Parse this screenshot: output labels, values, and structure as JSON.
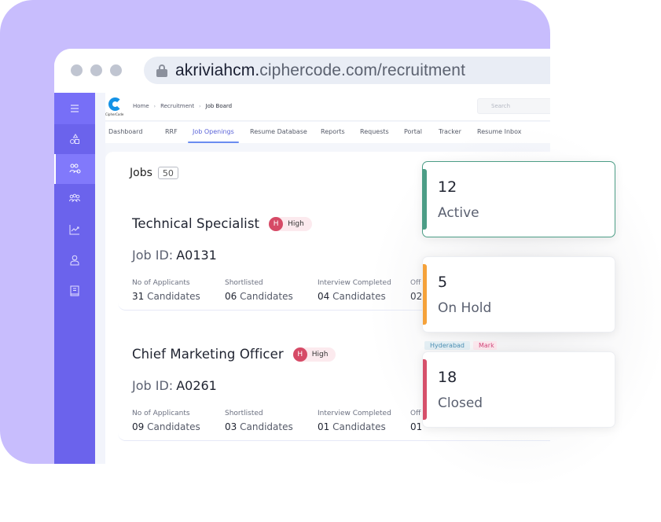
{
  "browser": {
    "url_host": "akriviahcm.",
    "url_rest": "ciphercode.com/recruitment"
  },
  "app": {
    "logo_text": "CipherCode",
    "breadcrumb": [
      "Home",
      "Recruitment",
      "Job Board"
    ],
    "search_placeholder": "Search",
    "tabs": [
      "Dashboard",
      "RRF",
      "Job Openings",
      "Resume Database",
      "Reports",
      "Requests",
      "Portal",
      "Tracker",
      "Resume Inbox"
    ],
    "active_tab": "Job Openings"
  },
  "sidebar": {
    "items": [
      {
        "icon": "menu-icon"
      },
      {
        "icon": "shapes-icon"
      },
      {
        "icon": "recruitment-icon",
        "active": true
      },
      {
        "icon": "team-icon"
      },
      {
        "icon": "analytics-icon"
      },
      {
        "icon": "user-icon"
      },
      {
        "icon": "book-icon"
      }
    ]
  },
  "jobs": {
    "title": "Jobs",
    "count": "50",
    "list": [
      {
        "title": "Technical Specialist",
        "priority_letter": "H",
        "priority": "High",
        "id_label": "Job ID:",
        "id": "A0131",
        "stats": [
          {
            "label": "No of Applicants",
            "value": "31",
            "unit": "Candidates"
          },
          {
            "label": "Shortlisted",
            "value": "06",
            "unit": "Candidates"
          },
          {
            "label": "Interview Completed",
            "value": "04",
            "unit": "Candidates"
          },
          {
            "label": "Off",
            "value": "02",
            "unit": ""
          }
        ]
      },
      {
        "title": "Chief Marketing Officer",
        "priority_letter": "H",
        "priority": "High",
        "id_label": "Job ID:",
        "id": "A0261",
        "stats": [
          {
            "label": "No of Applicants",
            "value": "09",
            "unit": "Candidates"
          },
          {
            "label": "Shortlisted",
            "value": "03",
            "unit": "Candidates"
          },
          {
            "label": "Interview Completed",
            "value": "01",
            "unit": "Candidates"
          },
          {
            "label": "Off",
            "value": "01",
            "unit": ""
          }
        ],
        "tags": [
          "Hyderabad",
          "Mark"
        ]
      }
    ]
  },
  "summary_cards": [
    {
      "count": "12",
      "label": "Active",
      "color": "#4c9d86"
    },
    {
      "count": "5",
      "label": "On Hold",
      "color": "#f5a23a"
    },
    {
      "count": "18",
      "label": "Closed",
      "color": "#d6506a"
    }
  ]
}
